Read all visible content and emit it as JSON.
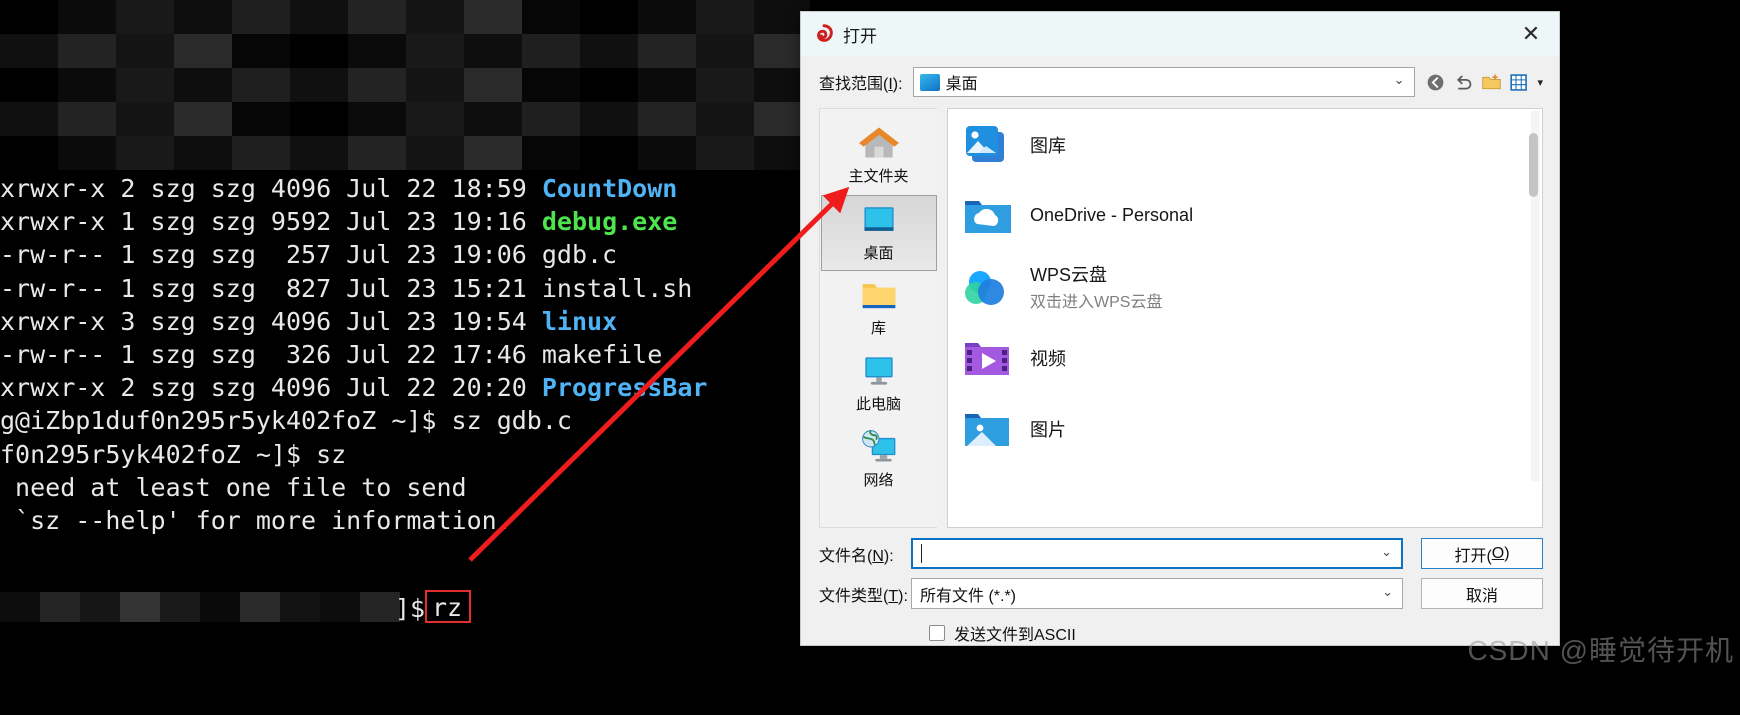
{
  "terminal": {
    "lines": [
      {
        "segments": [
          {
            "text": "xrwxr-x 2 szg szg 4096 Jul 22 18:59 ",
            "color": "white"
          },
          {
            "text": "CountDown",
            "color": "blue"
          }
        ]
      },
      {
        "segments": [
          {
            "text": "xrwxr-x 1 szg szg 9592 Jul 23 19:16 ",
            "color": "white"
          },
          {
            "text": "debug.exe",
            "color": "green"
          }
        ]
      },
      {
        "segments": [
          {
            "text": "-rw-r-- 1 szg szg  257 Jul 23 19:06 gdb.c",
            "color": "white"
          }
        ]
      },
      {
        "segments": [
          {
            "text": "-rw-r-- 1 szg szg  827 Jul 23 15:21 install.sh",
            "color": "white"
          }
        ]
      },
      {
        "segments": [
          {
            "text": "xrwxr-x 3 szg szg 4096 Jul 23 19:54 ",
            "color": "white"
          },
          {
            "text": "linux",
            "color": "blue"
          }
        ]
      },
      {
        "segments": [
          {
            "text": "-rw-r-- 1 szg szg  326 Jul 22 17:46 makefile",
            "color": "white"
          }
        ]
      },
      {
        "segments": [
          {
            "text": "xrwxr-x 2 szg szg 4096 Jul 22 20:20 ",
            "color": "white"
          },
          {
            "text": "ProgressBar",
            "color": "blue"
          }
        ]
      },
      {
        "segments": [
          {
            "text": "g@iZbp1duf0n295r5yk402foZ ~]$ sz gdb.c",
            "color": "white"
          }
        ]
      },
      {
        "segments": [
          {
            "text": "f0n295r5yk402foZ ~]$ sz",
            "color": "white"
          }
        ]
      },
      {
        "segments": [
          {
            "text": " need at least one file to send",
            "color": "white"
          }
        ]
      },
      {
        "segments": [
          {
            "text": " `sz --help' for more information.",
            "color": "white"
          }
        ]
      }
    ],
    "prompt_tail": "]$",
    "highlighted_command": "rz"
  },
  "dialog": {
    "title": "打开",
    "title_icon": "shell-spiral-icon",
    "close_label": "✕",
    "lookin": {
      "label_prefix": "查找范围(",
      "label_key": "I",
      "label_suffix": "):",
      "value": "桌面",
      "chevron": "⌄"
    },
    "toolbar": [
      {
        "name": "back-icon",
        "glyph": "◉"
      },
      {
        "name": "up-one-level-icon",
        "glyph": "⬑"
      },
      {
        "name": "new-folder-icon",
        "glyph": "🗀"
      },
      {
        "name": "view-mode-icon",
        "glyph": "▦"
      }
    ],
    "toolbar_dropdown": "▾",
    "places": [
      {
        "label": "主文件夹",
        "icon": "home-icon",
        "selected": false
      },
      {
        "label": "桌面",
        "icon": "desktop-icon",
        "selected": true
      },
      {
        "label": "库",
        "icon": "library-folder-icon",
        "selected": false
      },
      {
        "label": "此电脑",
        "icon": "this-pc-icon",
        "selected": false
      },
      {
        "label": "网络",
        "icon": "network-icon",
        "selected": false
      }
    ],
    "files": [
      {
        "name": "图库",
        "sub": "",
        "icon": "gallery-icon"
      },
      {
        "name": "OneDrive - Personal",
        "sub": "",
        "icon": "onedrive-icon"
      },
      {
        "name": "WPS云盘",
        "sub": "双击进入WPS云盘",
        "icon": "wps-cloud-icon"
      },
      {
        "name": "视频",
        "sub": "",
        "icon": "videos-folder-icon"
      },
      {
        "name": "图片",
        "sub": "",
        "icon": "pictures-folder-icon"
      }
    ],
    "filename": {
      "label_prefix": "文件名(",
      "label_key": "N",
      "label_suffix": "):",
      "value": "",
      "chevron": "⌄"
    },
    "filetype": {
      "label_prefix": "文件类型(",
      "label_key": "T",
      "label_suffix": "):",
      "value": "所有文件 (*.*)",
      "chevron": "⌄"
    },
    "buttons": {
      "open_prefix": "打开(",
      "open_key": "O",
      "open_suffix": ")",
      "cancel": "取消"
    },
    "ascii": {
      "label": "发送文件到ASCII",
      "checked": false
    }
  },
  "watermark": {
    "text": "CSDN @睡觉待开机"
  },
  "colors": {
    "accent": "#0a72c4",
    "terminal_blue": "#4fb3f5",
    "terminal_green": "#4ee44e",
    "annotation_red": "#ee1c1c"
  }
}
